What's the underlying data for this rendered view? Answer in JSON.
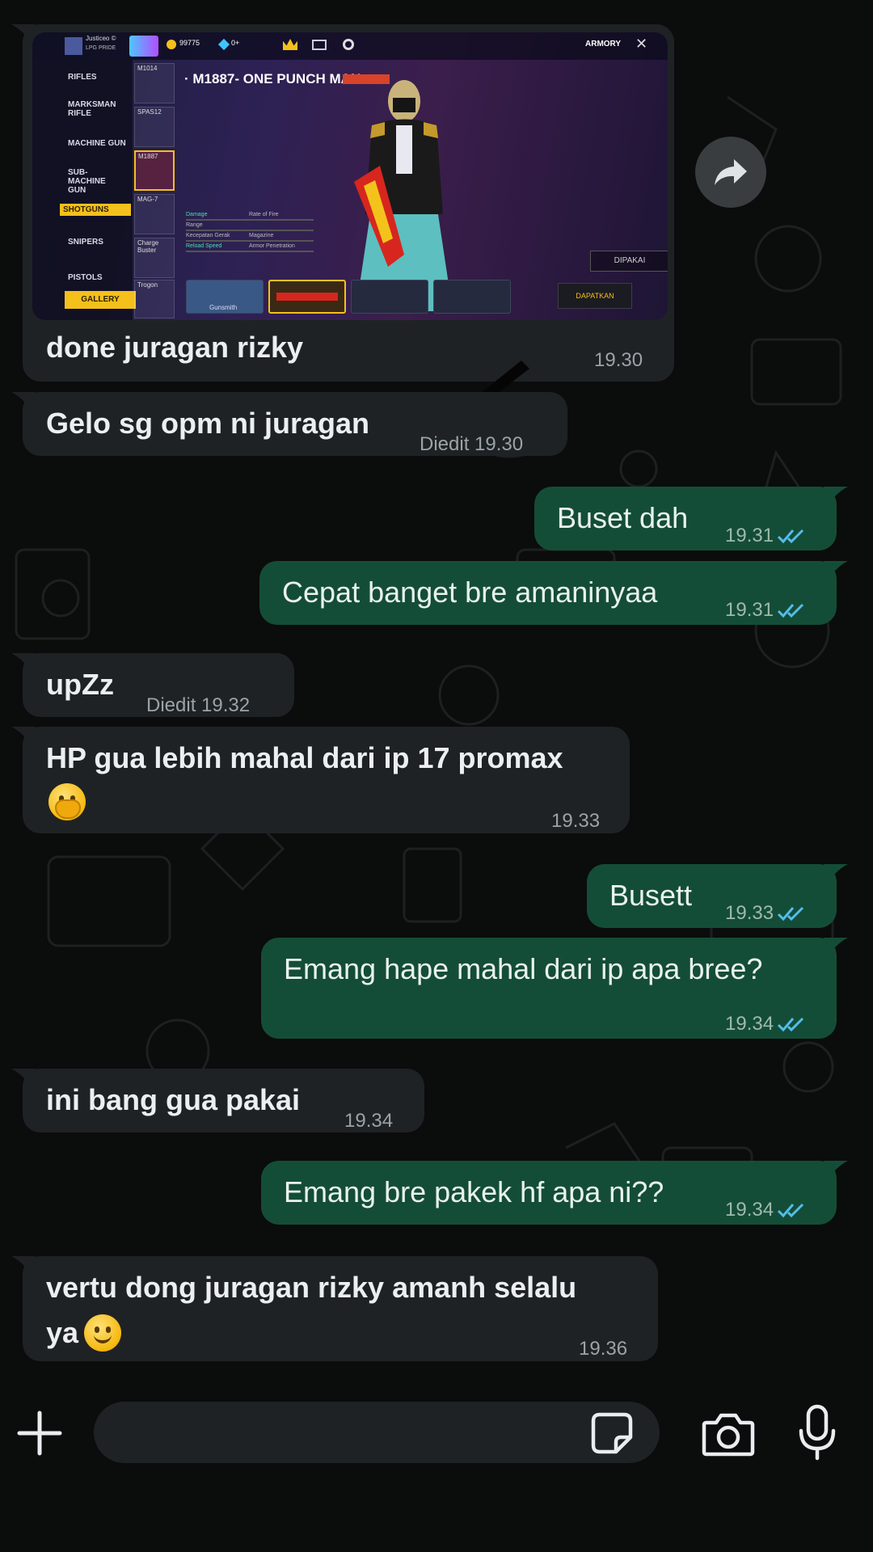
{
  "image_message": {
    "caption": "done juragan rizky",
    "time": "19.30",
    "screenshot": {
      "player_name": "Justiceo ©",
      "player_tag": "LPG PRIDE",
      "coins": "99775",
      "diamonds": "0+",
      "armory_label": "ARMORY",
      "weapon_title": "· M1887- ONE PUNCH MAN",
      "categories": [
        "RIFLES",
        "MARKSMAN RIFLE",
        "MACHINE GUN",
        "SUB-MACHINE GUN",
        "SHOTGUNS",
        "SNIPERS",
        "PISTOLS"
      ],
      "selected_category": "SHOTGUNS",
      "gallery_label": "GALLERY",
      "gun_slots": [
        "M1014",
        "SPAS12",
        "M1887",
        "MAG-7",
        "Charge Buster",
        "Trogon"
      ],
      "stats": [
        "Damage",
        "Range",
        "Kecepatan Gerak",
        "Reload Speed"
      ],
      "stats_right": [
        "Rate of Fire",
        "Magazine",
        "Armor Penetration"
      ],
      "dipakai_label": "DIPAKAI",
      "dapatkan_label": "DAPATKAN",
      "gunsmith_label": "Gunsmith"
    }
  },
  "messages": [
    {
      "id": "m1",
      "dir": "in",
      "text": "Gelo sg opm ni juragan",
      "meta": "Diedit 19.30"
    },
    {
      "id": "m2",
      "dir": "out",
      "text": "Buset dah",
      "meta": "19.31"
    },
    {
      "id": "m3",
      "dir": "out",
      "text": "Cepat banget bre amaninyaa",
      "meta": "19.31"
    },
    {
      "id": "m4",
      "dir": "in",
      "text": "upZz",
      "meta": "Diedit 19.32"
    },
    {
      "id": "m5",
      "dir": "in",
      "text": "HP gua lebih mahal dari ip 17 promax",
      "emoji": "face-with-hand-over-mouth",
      "meta": "19.33"
    },
    {
      "id": "m6",
      "dir": "out",
      "text": "Busett",
      "meta": "19.33"
    },
    {
      "id": "m7",
      "dir": "out",
      "text": "Emang hape mahal dari ip apa bree?",
      "meta": "19.34"
    },
    {
      "id": "m8",
      "dir": "in",
      "text": "ini bang gua pakai",
      "meta": "19.34"
    },
    {
      "id": "m9",
      "dir": "out",
      "text": "Emang bre pakek hf apa ni??",
      "meta": "19.34"
    },
    {
      "id": "m10",
      "dir": "in",
      "text_line1": "vertu dong juragan rizky amanh selalu",
      "text_line2": "ya",
      "emoji": "smiling-face",
      "meta": "19.36"
    }
  ],
  "composer": {
    "placeholder": "",
    "icons": [
      "plus-icon",
      "sticker-icon",
      "camera-icon",
      "microphone-icon"
    ]
  },
  "colors": {
    "background": "#0b0c0c",
    "incoming_bubble": "#1f2225",
    "outgoing_bubble": "#144d37",
    "read_ticks": "#53bdeb"
  }
}
